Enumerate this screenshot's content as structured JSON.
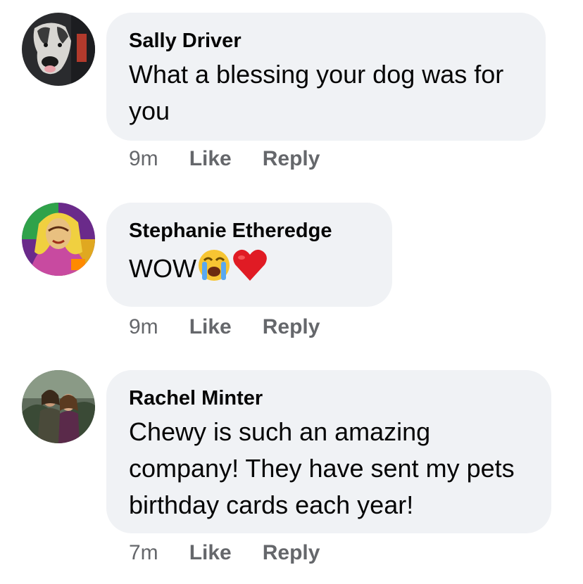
{
  "comments": [
    {
      "author": "Sally Driver",
      "text": "What a blessing your dog was for you",
      "time": "9m",
      "like_label": "Like",
      "reply_label": "Reply"
    },
    {
      "author": "Stephanie Etheredge",
      "text": "WOW",
      "emojis": [
        "crying-face-emoji",
        "red-heart-emoji"
      ],
      "time": "9m",
      "like_label": "Like",
      "reply_label": "Reply"
    },
    {
      "author": "Rachel Minter",
      "text": "Chewy is such an amazing company! They have sent my pets birthday cards each year!",
      "time": "7m",
      "like_label": "Like",
      "reply_label": "Reply"
    }
  ],
  "colors": {
    "bubble": "#f0f2f5",
    "meta_text": "#65676b",
    "body_text": "#050505"
  }
}
